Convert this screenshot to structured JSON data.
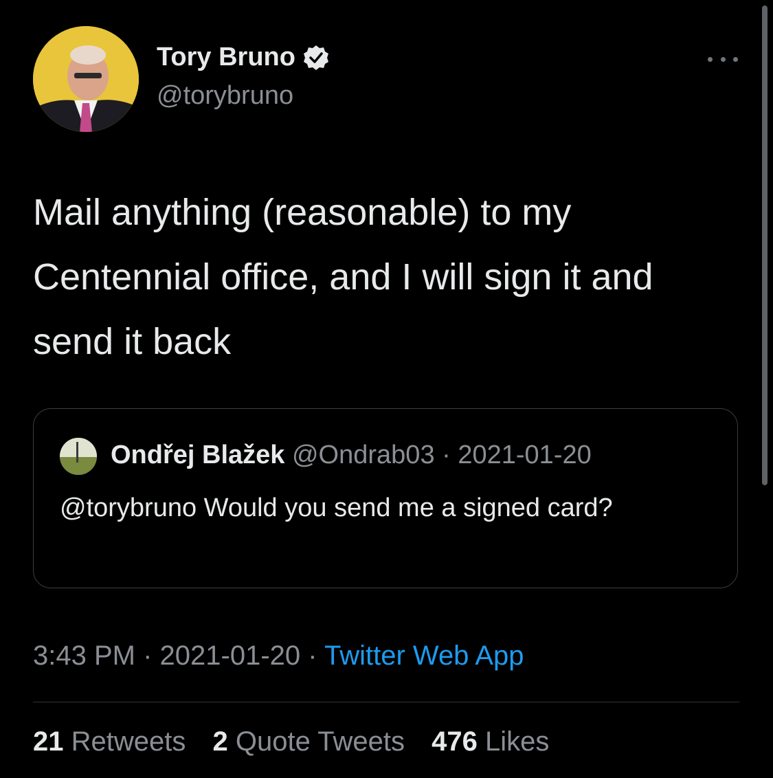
{
  "author": {
    "name": "Tory Bruno",
    "handle": "@torybruno",
    "verified_icon": "verified-badge-icon"
  },
  "tweet": {
    "text": "Mail anything (reasonable) to my Centennial office, and I will sign it and send it back"
  },
  "quoted_tweet": {
    "name": "Ondřej Blažek",
    "handle": "@Ondrab03",
    "separator": "·",
    "date": "2021-01-20",
    "text": "@torybruno Would you send me a signed card?"
  },
  "meta": {
    "time": "3:43 PM",
    "date": "2021-01-20",
    "separator": "·",
    "source": "Twitter Web App"
  },
  "stats": {
    "retweets_count": "21",
    "retweets_label": "Retweets",
    "quotes_count": "2",
    "quotes_label": "Quote Tweets",
    "likes_count": "476",
    "likes_label": "Likes"
  },
  "colors": {
    "background": "#000000",
    "text": "#e7e9ea",
    "secondary": "#8b8f94",
    "link": "#1d9bf0"
  }
}
